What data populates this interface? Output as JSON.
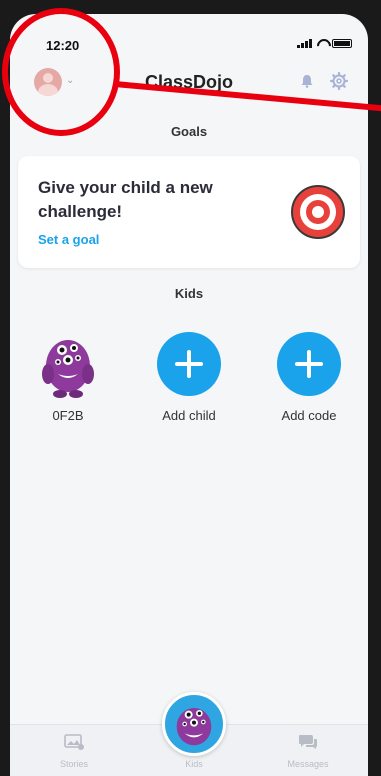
{
  "status_bar": {
    "time": "12:20"
  },
  "header": {
    "title": "ClassDojo"
  },
  "goals": {
    "section_title": "Goals",
    "card_text": "Give your child a new challenge!",
    "link_label": "Set a goal"
  },
  "kids": {
    "section_title": "Kids",
    "items": [
      {
        "label": "0F2B"
      },
      {
        "label": "Add child"
      },
      {
        "label": "Add code"
      }
    ]
  },
  "tabbar": {
    "tabs": [
      {
        "label": "Stories"
      },
      {
        "label": "Kids"
      },
      {
        "label": "Messages"
      }
    ]
  },
  "colors": {
    "accent": "#1aa3ea",
    "annotation": "#e8000e",
    "monster": "#8e3a9c"
  },
  "icons": [
    "bell-icon",
    "gear-icon",
    "target-icon",
    "plus-icon",
    "stories-icon",
    "messages-icon",
    "monster-avatar"
  ]
}
